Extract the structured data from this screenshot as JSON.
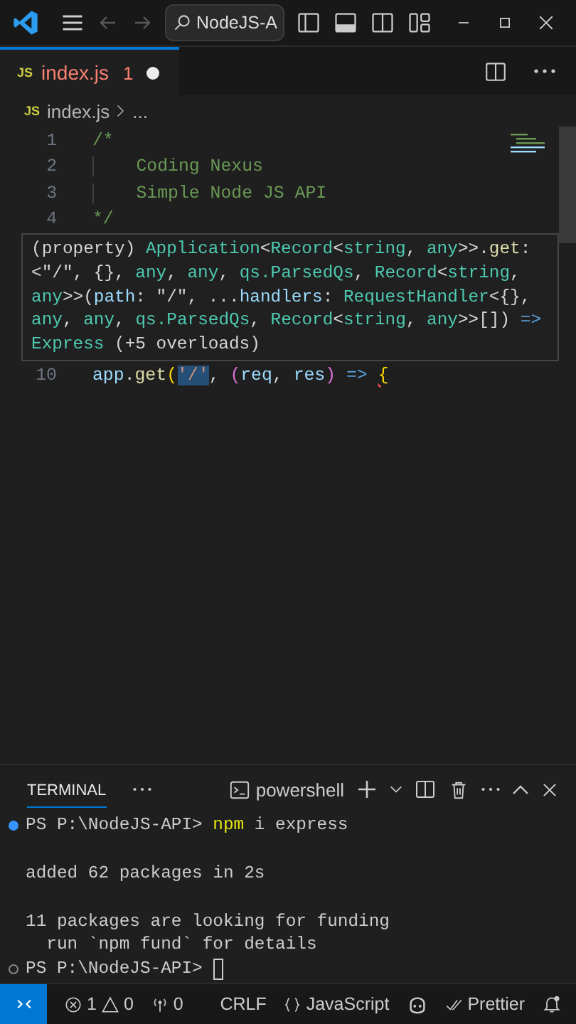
{
  "title_bar": {
    "search": {
      "value": "NodeJS-A"
    },
    "back_disabled": true,
    "forward_disabled": true
  },
  "tabs": [
    {
      "icon_label": "JS",
      "label": "index.js",
      "problems": "1",
      "dirty": true,
      "error": true,
      "selected": true
    }
  ],
  "breadcrumb": {
    "icon_label": "JS",
    "file": "index.js",
    "more": "..."
  },
  "editor": {
    "lines": [
      {
        "number": "1",
        "tokens": [
          {
            "text": "/*",
            "kind": "comment"
          }
        ]
      },
      {
        "number": "2",
        "indent": true,
        "tokens": [
          {
            "text": "    Coding Nexus",
            "kind": "comment"
          }
        ]
      },
      {
        "number": "3",
        "indent": true,
        "tokens": [
          {
            "text": "    Simple Node JS API",
            "kind": "comment"
          }
        ]
      },
      {
        "number": "4",
        "tokens": [
          {
            "text": "*/",
            "kind": "comment"
          }
        ]
      },
      {
        "number": "10",
        "tokens": [
          {
            "text": "app",
            "kind": "variable"
          },
          {
            "text": ".",
            "kind": "plain"
          },
          {
            "text": "get",
            "kind": "function"
          },
          {
            "text": "(",
            "kind": "bracket"
          },
          {
            "text": "'/'",
            "kind": "selected"
          },
          {
            "text": ", ",
            "kind": "plain"
          },
          {
            "text": "(",
            "kind": "bracket2"
          },
          {
            "text": "req",
            "kind": "variable"
          },
          {
            "text": ", ",
            "kind": "plain"
          },
          {
            "text": "res",
            "kind": "variable"
          },
          {
            "text": ")",
            "kind": "bracket2"
          },
          {
            "text": " => ",
            "kind": "keyword"
          },
          {
            "text": "{",
            "kind": "error"
          }
        ]
      }
    ],
    "hover": {
      "lines": [
        [
          {
            "text": "(property) ",
            "kind": "plain"
          },
          {
            "text": "Application",
            "kind": "type"
          },
          {
            "text": "<",
            "kind": "plain"
          },
          {
            "text": "Record",
            "kind": "type"
          },
          {
            "text": "<",
            "kind": "plain"
          },
          {
            "text": "string",
            "kind": "type"
          },
          {
            "text": ", ",
            "kind": "plain"
          },
          {
            "text": "any",
            "kind": "type"
          },
          {
            "text": ">>.",
            "kind": "plain"
          },
          {
            "text": "get",
            "kind": "function"
          },
          {
            "text": ":",
            "kind": "plain"
          }
        ],
        [
          {
            "text": "<\"/\", {}, ",
            "kind": "plain"
          },
          {
            "text": "any",
            "kind": "type"
          },
          {
            "text": ", ",
            "kind": "plain"
          },
          {
            "text": "any",
            "kind": "type"
          },
          {
            "text": ", ",
            "kind": "plain"
          },
          {
            "text": "qs.ParsedQs",
            "kind": "type"
          },
          {
            "text": ", ",
            "kind": "plain"
          },
          {
            "text": "Record",
            "kind": "type"
          },
          {
            "text": "<",
            "kind": "plain"
          },
          {
            "text": "string",
            "kind": "type"
          },
          {
            "text": ",",
            "kind": "plain"
          }
        ],
        [
          {
            "text": "any",
            "kind": "type"
          },
          {
            "text": ">>(",
            "kind": "plain"
          },
          {
            "text": "path",
            "kind": "param"
          },
          {
            "text": ": \"/\", ...",
            "kind": "plain"
          },
          {
            "text": "handlers",
            "kind": "param"
          },
          {
            "text": ": ",
            "kind": "plain"
          },
          {
            "text": "RequestHandler",
            "kind": "type"
          },
          {
            "text": "<{},",
            "kind": "plain"
          }
        ],
        [
          {
            "text": "any",
            "kind": "type"
          },
          {
            "text": ", ",
            "kind": "plain"
          },
          {
            "text": "any",
            "kind": "type"
          },
          {
            "text": ", ",
            "kind": "plain"
          },
          {
            "text": "qs.ParsedQs",
            "kind": "type"
          },
          {
            "text": ", ",
            "kind": "plain"
          },
          {
            "text": "Record",
            "kind": "type"
          },
          {
            "text": "<",
            "kind": "plain"
          },
          {
            "text": "string",
            "kind": "type"
          },
          {
            "text": ", ",
            "kind": "plain"
          },
          {
            "text": "any",
            "kind": "type"
          },
          {
            "text": ">>[]) ",
            "kind": "plain"
          },
          {
            "text": "=>",
            "kind": "keyword"
          }
        ],
        [
          {
            "text": "Express",
            "kind": "type"
          },
          {
            "text": " (+5 overloads)",
            "kind": "plain"
          }
        ]
      ]
    }
  },
  "panel": {
    "tabs": [
      {
        "label": "TERMINAL",
        "selected": true
      }
    ],
    "shell": "powershell"
  },
  "terminal": {
    "lines": [
      {
        "kind": "prompt",
        "succeeded": true,
        "prompt": "PS P:\\NodeJS-API> ",
        "command": "npm",
        "args": " i express"
      },
      {
        "kind": "blank"
      },
      {
        "kind": "output",
        "text": "added 62 packages in 2s"
      },
      {
        "kind": "blank"
      },
      {
        "kind": "output",
        "text": "11 packages are looking for funding"
      },
      {
        "kind": "output",
        "text": "  run `npm fund` for details"
      },
      {
        "kind": "prompt",
        "succeeded": false,
        "prompt": "PS P:\\NodeJS-API> ",
        "cursor": true
      }
    ]
  },
  "status_bar": {
    "errors": "1",
    "warnings": "0",
    "ports": "0",
    "line_ending": "CRLF",
    "language": "JavaScript",
    "formatter": "Prettier"
  }
}
